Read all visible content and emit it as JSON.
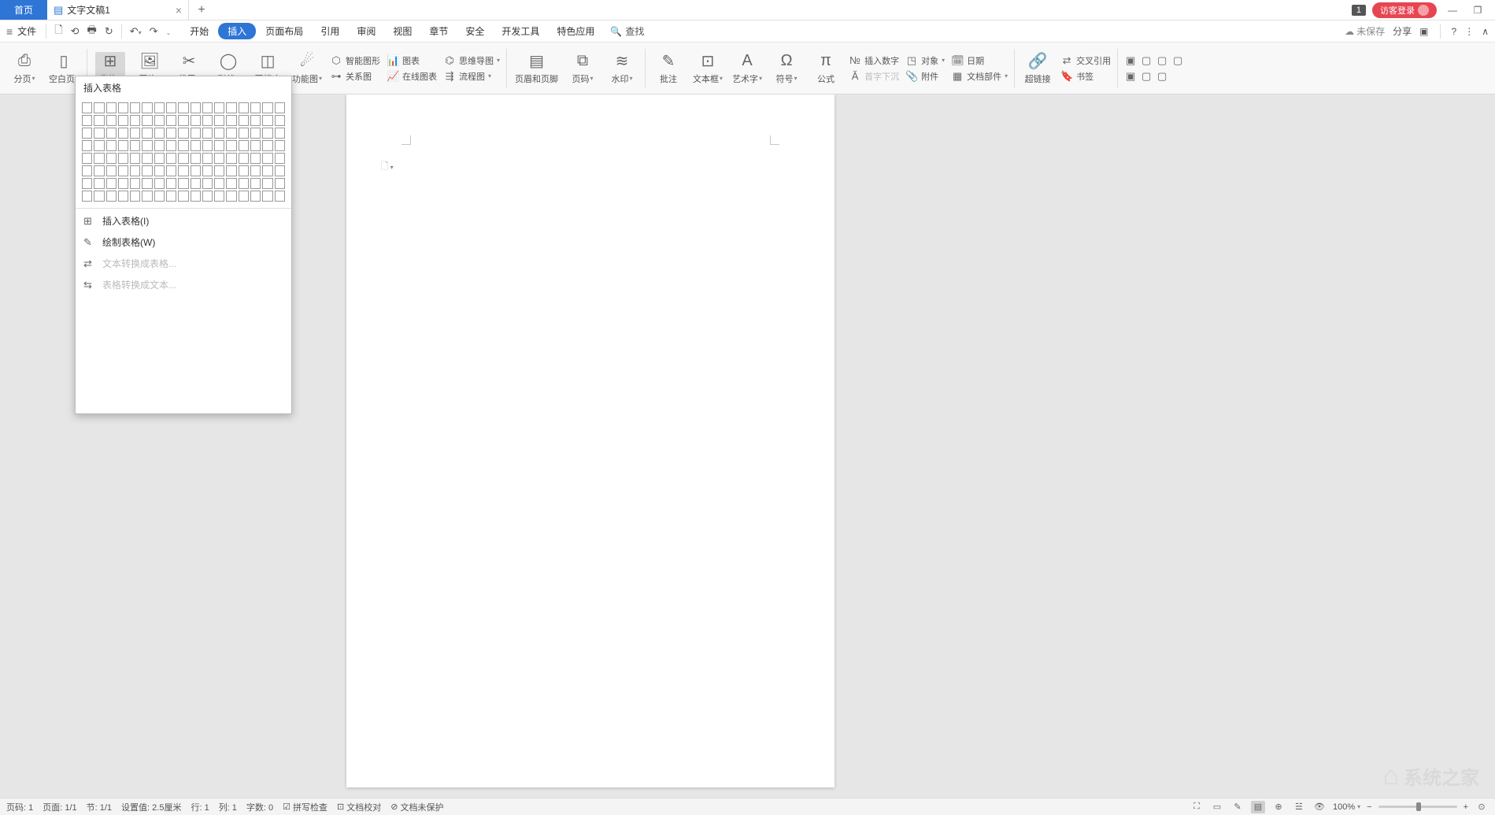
{
  "titlebar": {
    "home_tab": "首页",
    "doc_tab": "文字文稿1",
    "badge": "1",
    "login": "访客登录"
  },
  "menubar": {
    "file": "文件",
    "tabs": {
      "start": "开始",
      "insert": "插入",
      "layout": "页面布局",
      "refs": "引用",
      "review": "审阅",
      "view": "视图",
      "section": "章节",
      "security": "安全",
      "dev": "开发工具",
      "special": "特色应用"
    },
    "search": "查找",
    "not_saved": "未保存",
    "share": "分享"
  },
  "ribbon": {
    "page_break": "分页",
    "blank_page": "空白页",
    "table": "表格",
    "picture": "图片",
    "screenshot": "截屏",
    "shape": "形状",
    "icon_lib": "图标库",
    "func_chart": "功能图",
    "smart_shape": "智能图形",
    "chart": "图表",
    "relation": "关系图",
    "mindmap": "思维导图",
    "online_chart": "在线图表",
    "flowchart": "流程图",
    "header_footer": "页眉和页脚",
    "page_num": "页码",
    "watermark": "水印",
    "comment": "批注",
    "textbox": "文本框",
    "wordart": "艺术字",
    "symbol": "符号",
    "equation": "公式",
    "insert_num": "插入数字",
    "object": "对象",
    "drop_cap": "首字下沉",
    "attachment": "附件",
    "date": "日期",
    "doc_parts": "文档部件",
    "hyperlink": "超链接",
    "cross_ref": "交叉引用",
    "bookmark": "书签"
  },
  "table_dropdown": {
    "title": "插入表格",
    "insert_table": "插入表格(I)",
    "draw_table": "绘制表格(W)",
    "text_to_table": "文本转换成表格...",
    "table_to_text": "表格转换成文本..."
  },
  "statusbar": {
    "page_num": "页码: 1",
    "page": "页面: 1/1",
    "section": "节: 1/1",
    "pos": "设置值: 2.5厘米",
    "row": "行: 1",
    "col": "列: 1",
    "words": "字数: 0",
    "spell": "拼写检查",
    "proof": "文档校对",
    "protect": "文档未保护",
    "zoom": "100%"
  },
  "watermark_text": "系统之家"
}
